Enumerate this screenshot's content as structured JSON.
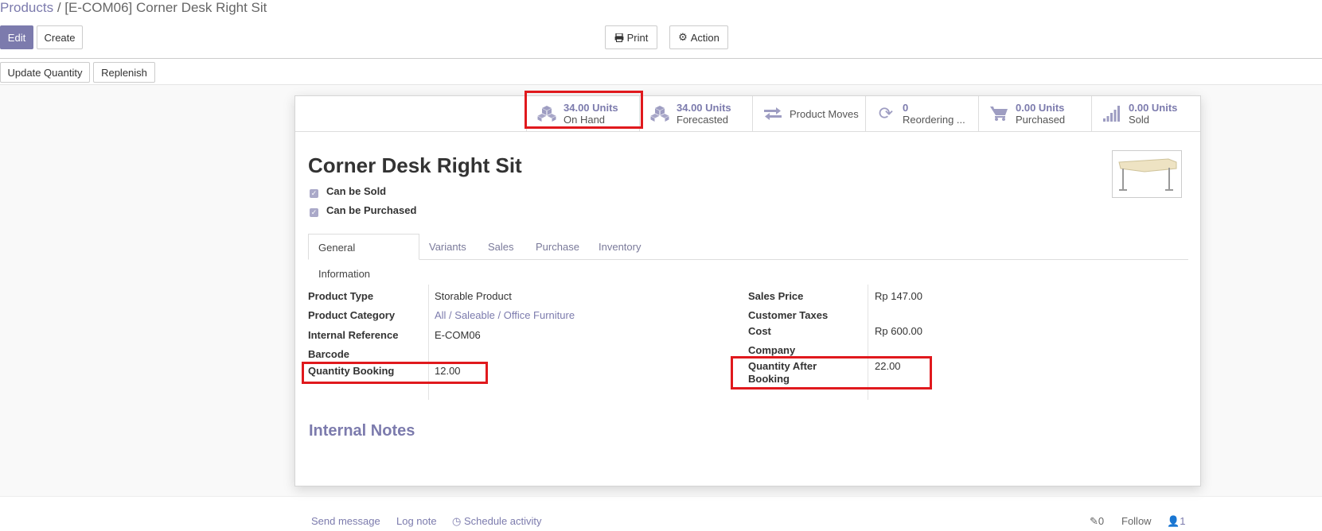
{
  "breadcrumb": {
    "parent": "Products",
    "separator": " / ",
    "current": "[E-COM06] Corner Desk Right Sit"
  },
  "toolbar": {
    "edit": "Edit",
    "create": "Create",
    "print": "Print",
    "action": "Action",
    "update_quantity": "Update Quantity",
    "replenish": "Replenish"
  },
  "smart_buttons": [
    {
      "value": "34.00 Units",
      "label": "On Hand",
      "icon": "cubes-icon"
    },
    {
      "value": "34.00 Units",
      "label": "Forecasted",
      "icon": "cubes-icon"
    },
    {
      "value": "",
      "label": "Product Moves",
      "icon": "exchange-icon"
    },
    {
      "value": "0",
      "label": "Reordering ...",
      "icon": "refresh-icon"
    },
    {
      "value": "0.00 Units",
      "label": "Purchased",
      "icon": "cart-icon"
    },
    {
      "value": "0.00 Units",
      "label": "Sold",
      "icon": "signal-icon"
    }
  ],
  "product": {
    "name": "Corner Desk Right Sit",
    "can_be_sold": "Can be Sold",
    "can_be_purchased": "Can be Purchased"
  },
  "tabs": [
    "General Information",
    "Variants",
    "Sales",
    "Purchase",
    "Inventory"
  ],
  "fields_left": [
    {
      "label": "Product Type",
      "value": "Storable Product"
    },
    {
      "label": "Product Category",
      "value": "All / Saleable / Office Furniture"
    },
    {
      "label": "Internal Reference",
      "value": "E-COM06"
    },
    {
      "label": "Barcode",
      "value": ""
    },
    {
      "label": "Quantity Booking",
      "value": "12.00"
    }
  ],
  "fields_right": [
    {
      "label": "Sales Price",
      "value": "Rp 147.00"
    },
    {
      "label": "Customer Taxes",
      "value": ""
    },
    {
      "label": "Cost",
      "value": "Rp 600.00"
    },
    {
      "label": "Company",
      "value": ""
    },
    {
      "label": "Quantity After Booking",
      "value": "22.00"
    }
  ],
  "internal_notes_heading": "Internal Notes",
  "chatter": {
    "send_message": "Send message",
    "log_note": "Log note",
    "schedule_activity": "Schedule activity",
    "attachments": "0",
    "follow": "Follow",
    "followers": "1"
  },
  "colors": {
    "accent": "#7c7bad",
    "highlight": "#e0191d"
  }
}
